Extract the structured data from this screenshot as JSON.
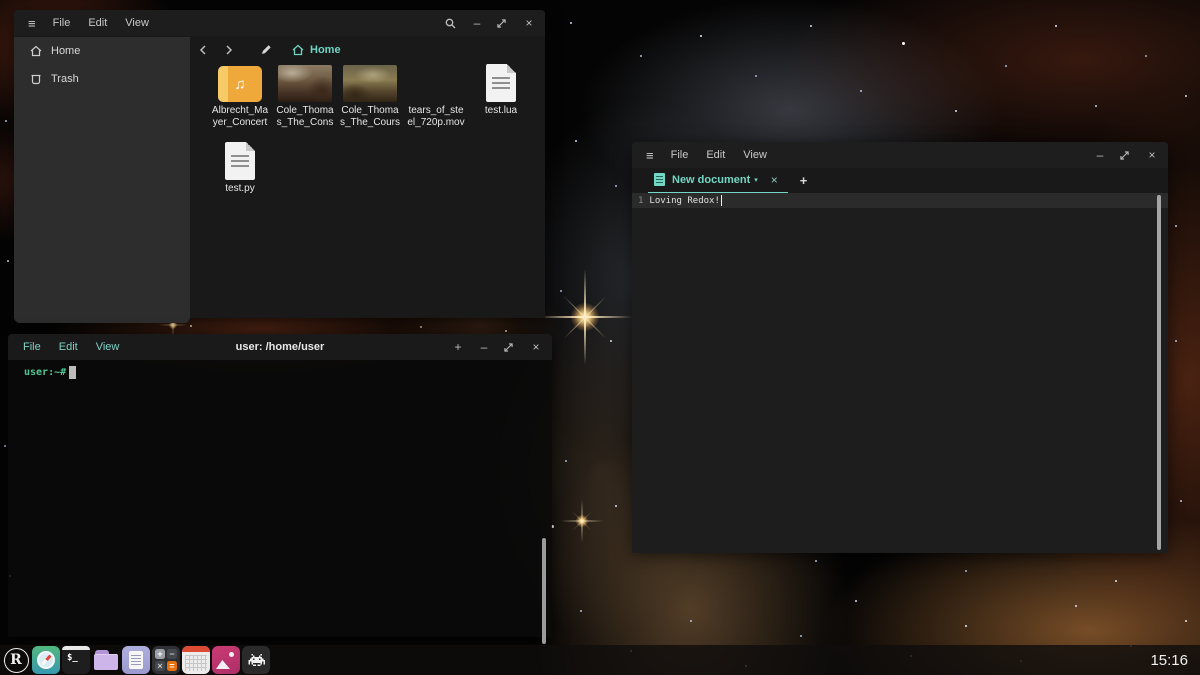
{
  "glyphs": {
    "hamburger": "≡",
    "minimize": "–",
    "close": "×",
    "plus": "+",
    "caret_down": "▾",
    "music_note": "♫"
  },
  "file_manager": {
    "menus": [
      "File",
      "Edit",
      "View"
    ],
    "sidebar_items": [
      {
        "label": "Home"
      },
      {
        "label": "Trash"
      }
    ],
    "breadcrumb": "Home",
    "files": [
      {
        "line1": "Albrecht_Ma",
        "line2": "yer_Concert",
        "kind": "audio"
      },
      {
        "line1": "Cole_Thoma",
        "line2": "s_The_Cons",
        "kind": "image"
      },
      {
        "line1": "Cole_Thoma",
        "line2": "s_The_Cours",
        "kind": "image"
      },
      {
        "line1": "tears_of_ste",
        "line2": "el_720p.mov",
        "kind": "video"
      },
      {
        "line1": "test.lua",
        "line2": "",
        "kind": "document"
      },
      {
        "line1": "test.py",
        "line2": "",
        "kind": "document"
      }
    ]
  },
  "terminal": {
    "menus": [
      "File",
      "Edit",
      "View"
    ],
    "title": "user: /home/user",
    "prompt": "user:~#"
  },
  "editor": {
    "menus": [
      "File",
      "Edit",
      "View"
    ],
    "tab_label": "New document",
    "line_number": "1",
    "line_text": "Loving Redox!"
  },
  "taskbar": {
    "redox_letter": "R",
    "terminal_glyph": "$_",
    "calculator": {
      "plus": "+",
      "minus": "−",
      "multiply": "×",
      "equals": "="
    },
    "clock": "15:16"
  }
}
